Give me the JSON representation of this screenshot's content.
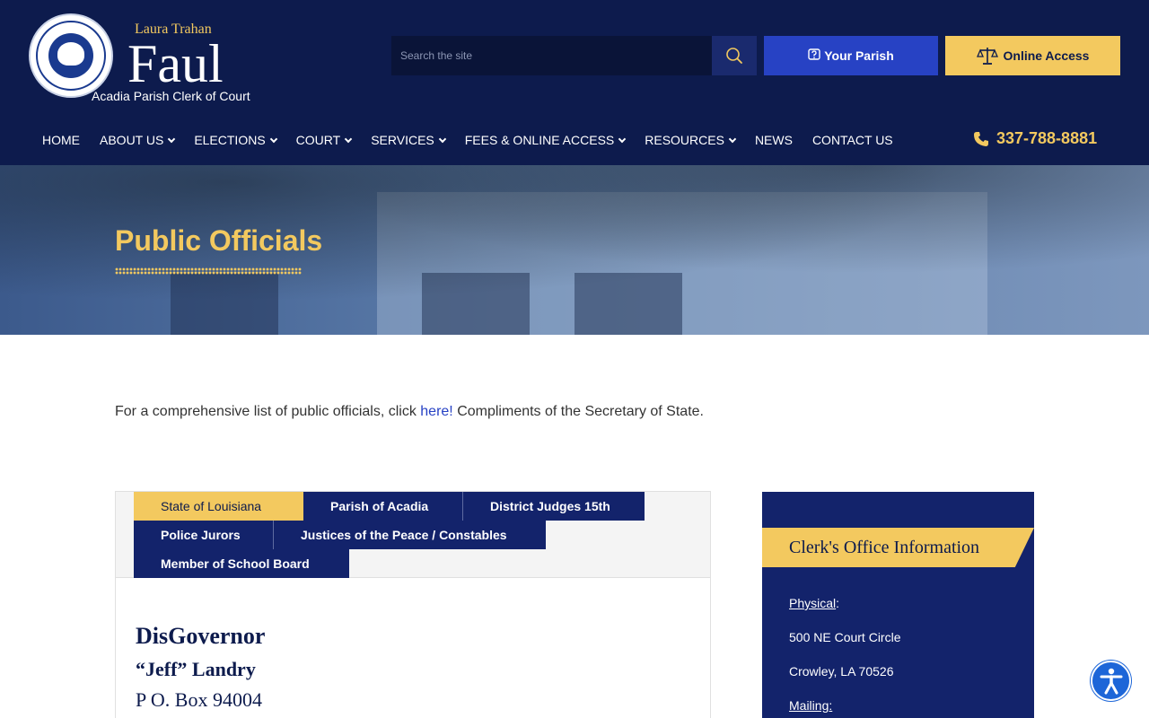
{
  "header": {
    "logo_top": "Laura Trahan",
    "logo_main": "Faul",
    "logo_sub": "Acadia Parish Clerk of Court",
    "seal_text": "STATE OF LOUISIANA · ACADIA PARISH CLERK OF COURT",
    "search_placeholder": "Search the site",
    "parish_button": "Your Parish",
    "online_button": "Online Access",
    "phone": "337-788-8881"
  },
  "nav": {
    "items": [
      {
        "label": "HOME",
        "dropdown": false
      },
      {
        "label": "ABOUT US",
        "dropdown": true
      },
      {
        "label": "ELECTIONS",
        "dropdown": true
      },
      {
        "label": "COURT",
        "dropdown": true
      },
      {
        "label": "SERVICES",
        "dropdown": true
      },
      {
        "label": "FEES & ONLINE ACCESS",
        "dropdown": true
      },
      {
        "label": "RESOURCES",
        "dropdown": true
      },
      {
        "label": "NEWS",
        "dropdown": false
      },
      {
        "label": "CONTACT US",
        "dropdown": false
      }
    ]
  },
  "hero": {
    "title": "Public Officials"
  },
  "intro": {
    "before": "For a comprehensive list of public officials, click ",
    "link": "here!",
    "after": " Compliments of the Secretary of State."
  },
  "tabs": {
    "items": [
      "State of Louisiana",
      "Parish of Acadia",
      "District Judges 15th",
      "Police Jurors",
      "Justices of the Peace / Constables",
      "Member of School Board"
    ],
    "active": "State of Louisiana"
  },
  "official": {
    "title": "DisGovernor",
    "name": "“Jeff” Landry",
    "address": "P O. Box 94004"
  },
  "sidebar": {
    "heading": "Clerk's Office Information",
    "physical_label": "Physical",
    "physical_colon": ":",
    "street": "500 NE Court Circle",
    "city": "Crowley, LA 70526",
    "mailing_label": "Mailing:"
  },
  "colors": {
    "navy": "#0d1b4d",
    "panel_navy": "#13236b",
    "gold": "#f3c95f",
    "blue_button": "#2742c4",
    "link": "#2742c4"
  },
  "icons": [
    "search-icon",
    "question-icon",
    "scales-icon",
    "phone-icon",
    "accessibility-icon",
    "chevron-down-icon"
  ]
}
